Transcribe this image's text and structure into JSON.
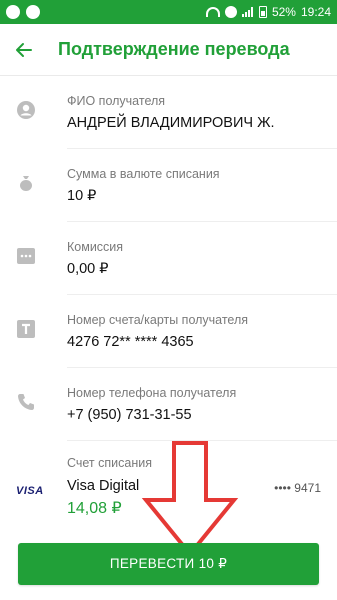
{
  "status_bar": {
    "battery": "52%",
    "time": "19:24"
  },
  "header": {
    "title": "Подтверждение перевода"
  },
  "details": [
    {
      "label": "ФИО получателя",
      "value": "АНДРЕЙ ВЛАДИМИРОВИЧ Ж.",
      "icon": "user-icon"
    },
    {
      "label": "Сумма в валюте списания",
      "value": "10 ₽",
      "icon": "money-bag-icon"
    },
    {
      "label": "Комиссия",
      "value": "0,00 ₽",
      "icon": "commission-icon"
    },
    {
      "label": "Номер счета/карты получателя",
      "value": "4276 72** **** 4365",
      "icon": "card-number-icon"
    },
    {
      "label": "Номер телефона получателя",
      "value": "+7 (950) 731-31-55",
      "icon": "phone-icon"
    }
  ],
  "account": {
    "label": "Счет списания",
    "brand": "VISA",
    "name": "Visa Digital",
    "mask": "•••• 9471",
    "balance": "14,08 ₽"
  },
  "action": {
    "button_label": "ПЕРЕВЕСТИ 10 ₽"
  },
  "colors": {
    "accent": "#21a038",
    "annotation_arrow": "#e53935"
  }
}
